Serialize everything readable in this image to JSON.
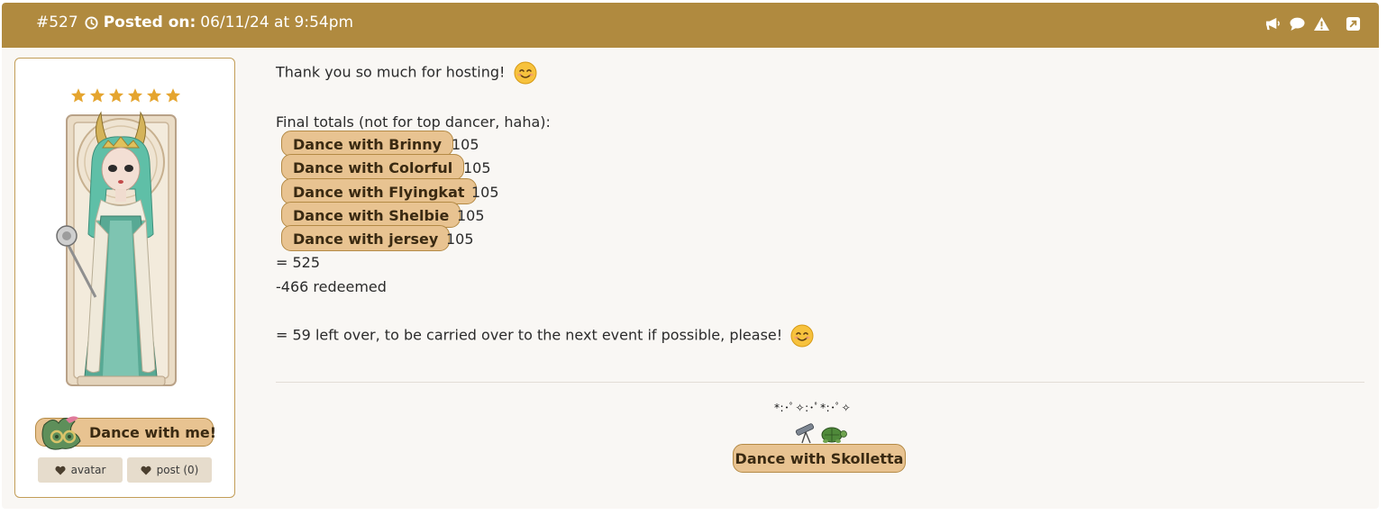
{
  "header": {
    "post_number": "#527",
    "posted_label": "Posted on:",
    "posted_value": "06/11/24 at 9:54pm",
    "icons": [
      "megaphone-icon",
      "speech-bubble-icon",
      "warning-icon",
      "external-link-icon"
    ]
  },
  "sidebar": {
    "star_count": 6,
    "star_color": "#e5a52f",
    "dance_button_label": "Dance with me!",
    "avatar_button_label": "avatar",
    "post_button_label": "post (0)"
  },
  "post": {
    "thanks_line": "Thank you so much for hosting!",
    "totals_intro": "Final totals (not for top dancer, haha):",
    "dances": [
      {
        "label": "Dance with Brinny",
        "count": "105"
      },
      {
        "label": "Dance with Colorful",
        "count": "105"
      },
      {
        "label": "Dance with Flyingkat",
        "count": "105"
      },
      {
        "label": "Dance with Shelbie",
        "count": "105"
      },
      {
        "label": "Dance with jersey",
        "count": "105"
      }
    ],
    "sum_line": "= 525",
    "redeemed_line": "-466 redeemed",
    "leftover_line": "= 59 left over, to be carried over to the next event if possible, please!"
  },
  "signature": {
    "sparkle_line": "*:･ﾟ✧:･ﾟ*:･ﾟ✧",
    "dance_label": "Dance with Skolletta"
  },
  "colors": {
    "header_bg": "#b08a3f",
    "pill_bg": "#e8c391",
    "pill_border": "#b48a45",
    "post_bg": "#f9f7f4"
  }
}
